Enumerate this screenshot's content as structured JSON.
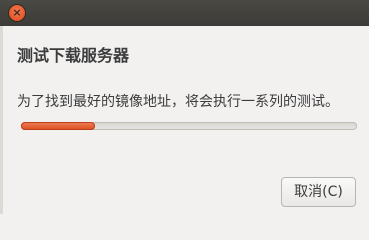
{
  "dialog": {
    "close_icon": "×",
    "heading": "测试下载服务器",
    "message": "为了找到最好的镜像地址，将会执行一系列的测试。",
    "progress": 0.22,
    "cancel_label": "取消(C)"
  },
  "colors": {
    "titlebar": "#3c3b37",
    "close_button": "#dd4814",
    "progress_fill": "#dc4c1b",
    "background": "#f2f1f0"
  }
}
